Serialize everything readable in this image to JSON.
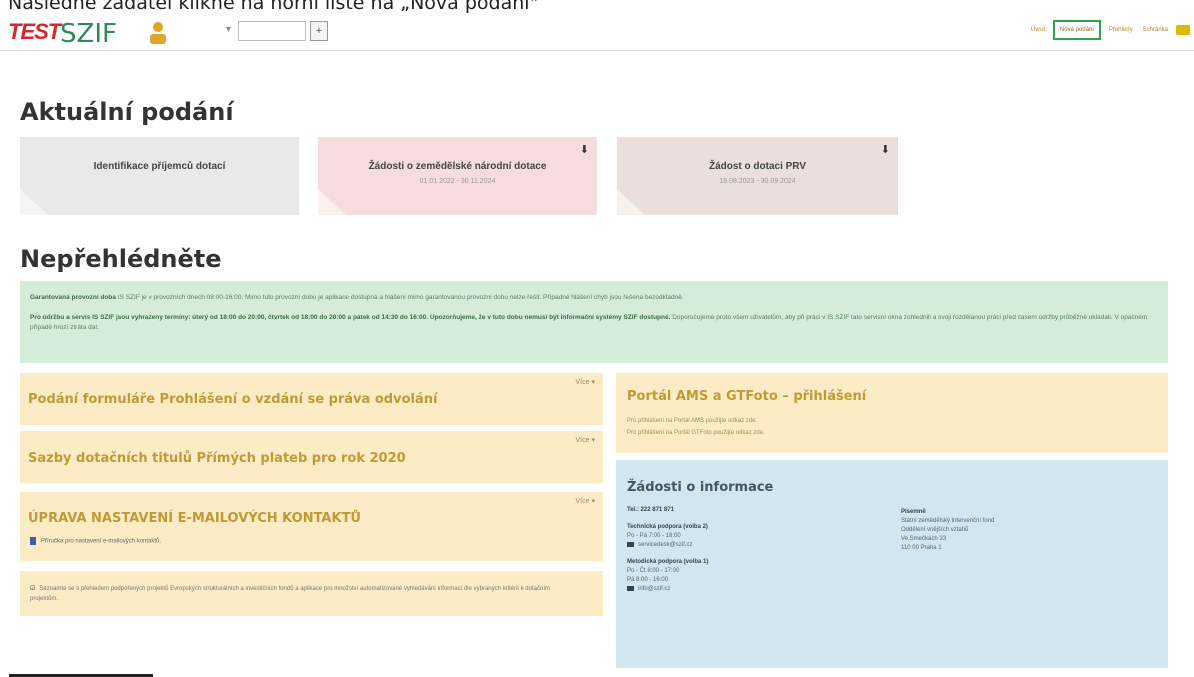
{
  "instruction": "Následně zadatel klikne na horní liště na „Nová podání\"",
  "header": {
    "logo_test": "TEST",
    "logo_szif": "SZIF",
    "select_label": "▾",
    "select_button": "+",
    "nav": [
      {
        "label": "Úvod"
      },
      {
        "label": "Nová podání"
      },
      {
        "label": "Přehledy"
      },
      {
        "label": "Schránka"
      }
    ]
  },
  "current": {
    "heading": "Aktuální podání",
    "tiles": [
      {
        "title": "Identifikace příjemců dotací",
        "subtitle": ""
      },
      {
        "title": "Žádosti o zemědělské národní dotace",
        "subtitle": "01.01.2022 - 30.11.2024"
      },
      {
        "title": "Žádost o dotaci PRV",
        "subtitle": "18.08.2023 - 30.09.2024"
      }
    ]
  },
  "notice": {
    "heading": "Nepřehlédněte",
    "para1_bold": "Garantovaná provozní doba",
    "para1": " IS SZIF je v provozních dnech 08:00-16:00. Mimo tuto provozní dobu je aplikace dostupná a hlášení mimo garantovanou provozní dobu nelze řešit. Případné hlášení chyb jsou řešena bezodkladně.",
    "para2_bold": "Pro údržbu a servis IS SZIF jsou vyhrazeny termíny: úterý od 18:00 do 20:00, čtvrtek od 18:00 do 20:00 a pátek od 14:30 do 16:00. Upozorňujeme, že v tuto dobu nemusí být informační systémy SZIF dostupné.",
    "para2": " Doporučujeme proto všem uživatelům, aby při práci v IS SZIF tato servisní okna zohlednili a svoji rozdělanou práci před časem údržby průběžně ukládali. V opačném případě hrozí ztráta dat."
  },
  "left_boxes": [
    {
      "title": "Podání formuláře Prohlášení o vzdání se práva odvolání",
      "more": "Více"
    },
    {
      "title": "Sazby dotačních titulů Přímých plateb pro rok 2020",
      "more": "Více"
    },
    {
      "title": "ÚPRAVA NASTAVENÍ E-MAILOVÝCH KONTAKTŮ",
      "more": "Více",
      "link": "Příručka pro nastavení e-mailových kontaktů."
    }
  ],
  "bottom_left_text": "Seznamte se s přehledem podpořených projektů Evropských strukturálních a investičních fondů a aplikace pro množství automatizované vyhledávání informací dle vybraných kritérií k dotačním projektům.",
  "portal": {
    "title": "Portál AMS a GTFoto – přihlášení",
    "line1": "Pro přihlášení na Portál AMS použijte odkaz zde.",
    "line2": "Pro přihlášení na Portál GTFoto použijte odkaz zde."
  },
  "info": {
    "title": "Žádosti o informace",
    "phone": "Tel.: 222 871 871",
    "tech_label": "Technická podpora (volba 2)",
    "tech_hours": "Po - Pá 7:00 - 18:00",
    "tech_email": "servicedesk@szif.cz",
    "method_label": "Metodická podpora (volba 1)",
    "method_hours1": "Po - Čt 8:00 - 17:00",
    "method_hours2": "Pá 8:00 - 16:00",
    "method_email": "info@szif.cz",
    "addr_label": "Písemně",
    "addr1": "Státní zemědělský intervenční fond",
    "addr2": "Oddělení vnějších vztahů",
    "addr3": "Ve Smečkách 33",
    "addr4": "110 00 Praha 1"
  }
}
